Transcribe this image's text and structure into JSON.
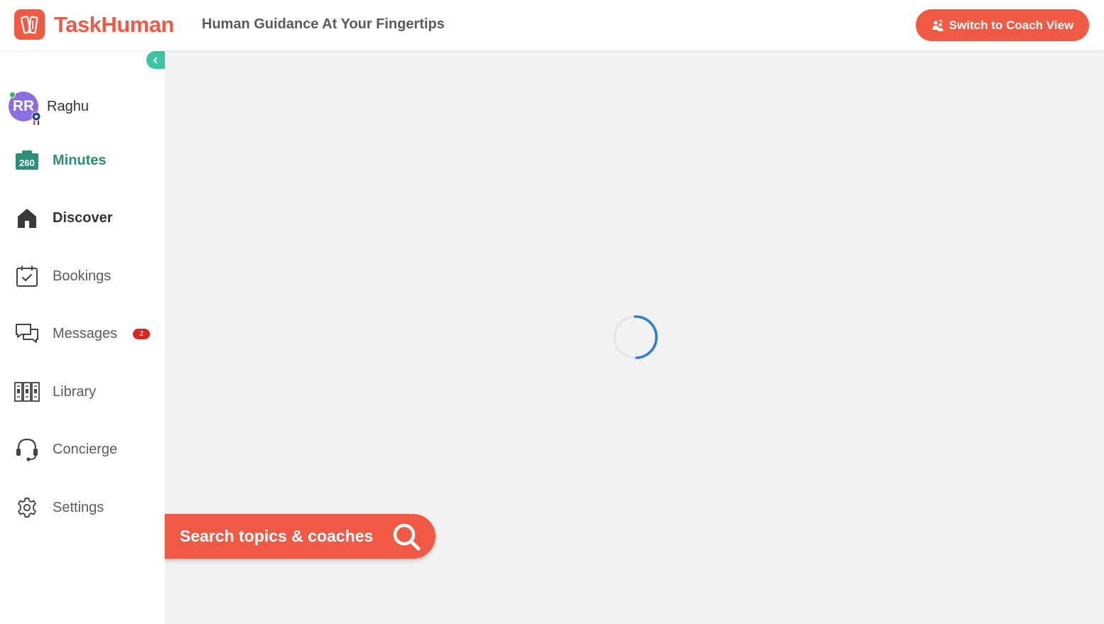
{
  "header": {
    "app_name": "TaskHuman",
    "tagline": "Human Guidance At Your Fingertips",
    "switch_button_label": "Switch to Coach View"
  },
  "sidebar": {
    "user": {
      "initials": "RR",
      "name": "Raghu"
    },
    "minutes": {
      "count": "260",
      "label": "Minutes"
    },
    "items": [
      {
        "label": "Discover",
        "icon": "home-icon",
        "active": true
      },
      {
        "label": "Bookings",
        "icon": "calendar-check-icon"
      },
      {
        "label": "Messages",
        "icon": "chat-icon",
        "badge": "2"
      },
      {
        "label": "Library",
        "icon": "library-icon"
      },
      {
        "label": "Concierge",
        "icon": "headset-icon"
      },
      {
        "label": "Settings",
        "icon": "gear-icon"
      }
    ]
  },
  "search": {
    "label": "Search topics & coaches"
  },
  "colors": {
    "brand": "#f05a44",
    "accent": "#3cc5a2",
    "minutes": "#2e8f78",
    "badge": "#d9251c",
    "spinner": "#2b7fd4"
  }
}
